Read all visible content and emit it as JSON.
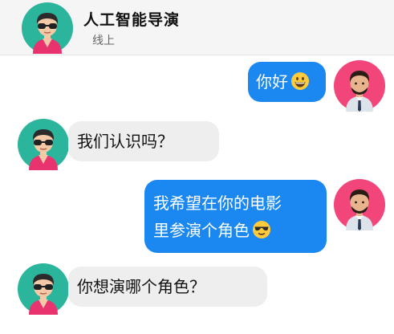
{
  "header": {
    "title": "人工智能导演",
    "status": "线上",
    "avatar_icon": "bot-avatar-sunglasses"
  },
  "messages": [
    {
      "side": "out",
      "text": "你好",
      "emoji": "grinning-face"
    },
    {
      "side": "in",
      "text": "我们认识吗？"
    },
    {
      "side": "out",
      "lines": [
        "我希望在你的电影",
        "里参演个角色"
      ],
      "emoji": "smiling-face-with-sunglasses"
    },
    {
      "side": "in",
      "text": "你想演哪个角色？"
    }
  ],
  "colors": {
    "outgoing_bubble": "#1a88f0",
    "incoming_bubble": "#eeeeee",
    "bot_avatar_bg": "#2bb59c",
    "user_avatar_bg": "#f2457a"
  }
}
